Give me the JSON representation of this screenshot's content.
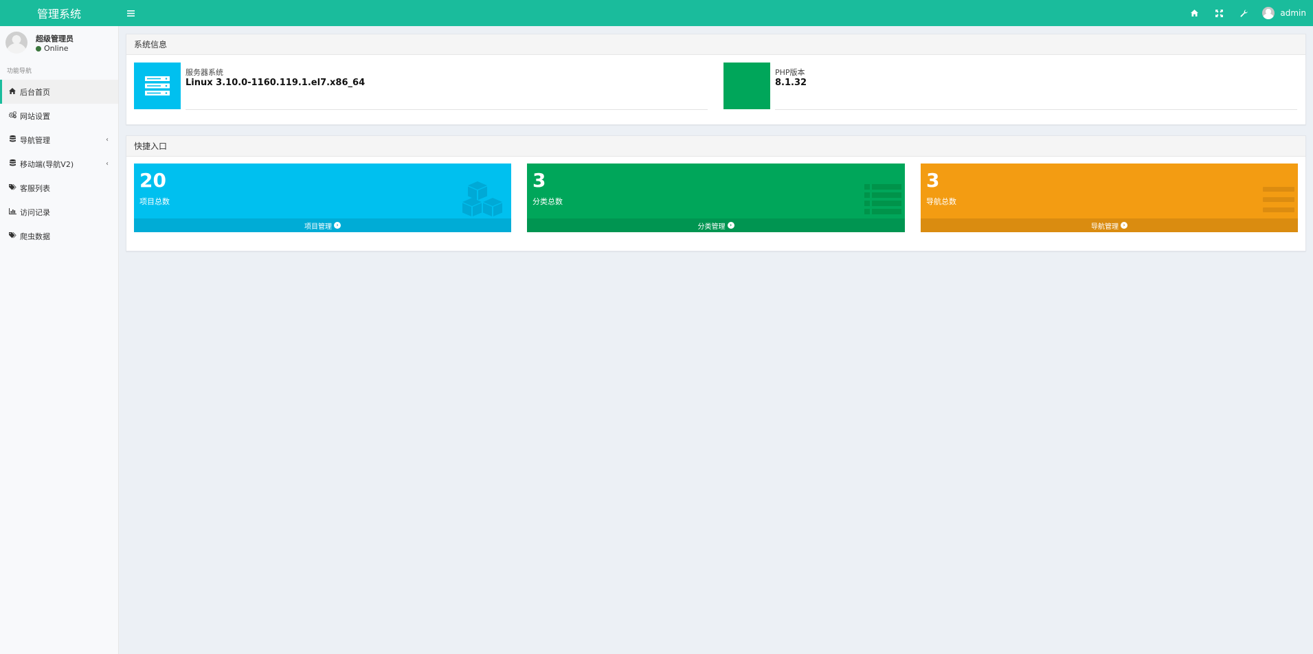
{
  "app": {
    "brand": "管理系统"
  },
  "topbar": {
    "menu_icon": "bars-icon",
    "icons": [
      "home-icon",
      "fullscreen-icon",
      "wrench-icon"
    ],
    "user_name": "admin"
  },
  "sidebar": {
    "user": {
      "name": "超级管理员",
      "status": "Online",
      "status_color": "#3c763d"
    },
    "nav_header": "功能导航",
    "items": [
      {
        "label": "后台首页",
        "icon": "home-icon",
        "active": true,
        "has_children": false
      },
      {
        "label": "网站设置",
        "icon": "gears-icon",
        "active": false,
        "has_children": false
      },
      {
        "label": "导航管理",
        "icon": "database-icon",
        "active": false,
        "has_children": true
      },
      {
        "label": "移动端(导航V2)",
        "icon": "database-icon",
        "active": false,
        "has_children": true
      },
      {
        "label": "客服列表",
        "icon": "tags-icon",
        "active": false,
        "has_children": false
      },
      {
        "label": "访问记录",
        "icon": "bar-chart-icon",
        "active": false,
        "has_children": false
      },
      {
        "label": "爬虫数据",
        "icon": "tags-icon",
        "active": false,
        "has_children": false
      }
    ]
  },
  "system_info": {
    "title": "系统信息",
    "items": [
      {
        "label": "服务器系统",
        "value": "Linux 3.10.0-1160.119.1.el7.x86_64",
        "color": "#00c0ef",
        "icon": "server-icon"
      },
      {
        "label": "PHP版本",
        "value": "8.1.32",
        "color": "#00a65a",
        "icon": ""
      }
    ]
  },
  "quick_entry": {
    "title": "快捷入口",
    "cards": [
      {
        "number": "20",
        "label": "项目总数",
        "footer": "项目管理",
        "color": "#00c0ef",
        "footer_color": "#00acd6",
        "icon": "cubes-icon"
      },
      {
        "number": "3",
        "label": "分类总数",
        "footer": "分类管理",
        "color": "#00a65a",
        "footer_color": "#009551",
        "icon": "list-icon"
      },
      {
        "number": "3",
        "label": "导航总数",
        "footer": "导航管理",
        "color": "#f39c12",
        "footer_color": "#da8c10",
        "icon": "bars-icon"
      }
    ]
  },
  "colors": {
    "topbar": "#1abc9c",
    "page_bg": "#ecf0f5"
  }
}
